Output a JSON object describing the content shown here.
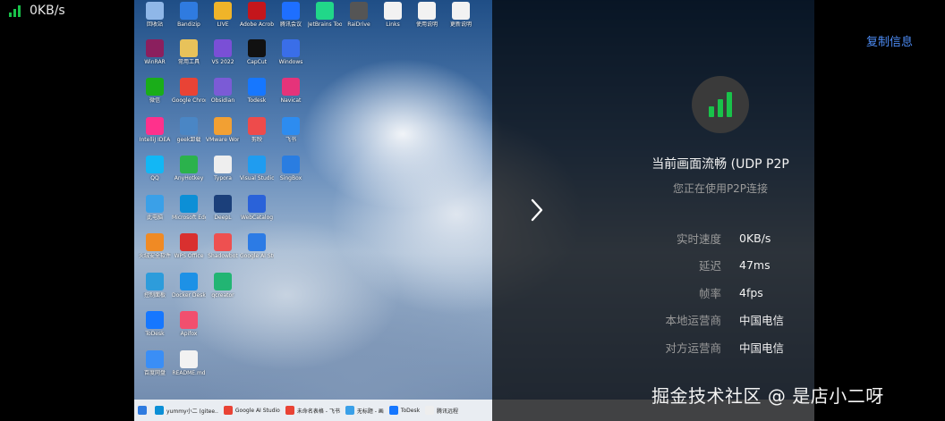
{
  "overlay": {
    "speed": "0KB/s"
  },
  "desktop": {
    "icons": [
      {
        "label": "回收站",
        "color": "#8fb7e8"
      },
      {
        "label": "Bandizip",
        "color": "#2f7be0"
      },
      {
        "label": "LIVE",
        "color": "#f0b429"
      },
      {
        "label": "Adobe Acrobat DC",
        "color": "#c4161c"
      },
      {
        "label": "腾讯会议",
        "color": "#1e6fff"
      },
      {
        "label": "JetBrains Toolbox",
        "color": "#21d789"
      },
      {
        "label": "RaiDrive",
        "color": "#555555"
      },
      {
        "label": "Links",
        "color": "#f2f2f2"
      },
      {
        "label": "使用说明",
        "color": "#f2f2f2"
      },
      {
        "label": "更新说明",
        "color": "#f2f2f2"
      },
      {
        "label": "WinRAR",
        "color": "#8b1f5e"
      },
      {
        "label": "常用工具",
        "color": "#e8c25a"
      },
      {
        "label": "VS 2022",
        "color": "#7a4fd6"
      },
      {
        "label": "CapCut",
        "color": "#111111"
      },
      {
        "label": "Windows",
        "color": "#3a6ee8"
      },
      {
        "label": "微信",
        "color": "#1aad19"
      },
      {
        "label": "Google Chrome",
        "color": "#e94335"
      },
      {
        "label": "Obsidian",
        "color": "#7b5bd6"
      },
      {
        "label": "Todesk",
        "color": "#1677ff"
      },
      {
        "label": "Navicat",
        "color": "#e5337a"
      },
      {
        "label": "IntelliJ IDEA",
        "color": "#ff318c"
      },
      {
        "label": "geek卸载",
        "color": "#4a86c5"
      },
      {
        "label": "VMware Workstation",
        "color": "#f2a033"
      },
      {
        "label": "剪映",
        "color": "#ee4b4b"
      },
      {
        "label": "飞书",
        "color": "#2d8cf0"
      },
      {
        "label": "QQ",
        "color": "#12b7f5"
      },
      {
        "label": "AnyHotkey",
        "color": "#2bb24c"
      },
      {
        "label": "Typora",
        "color": "#eeeeee"
      },
      {
        "label": "Visual Studio Code",
        "color": "#1f9cf0"
      },
      {
        "label": "SingBox",
        "color": "#2a7de1"
      },
      {
        "label": "此电脑",
        "color": "#3aa0e8"
      },
      {
        "label": "Microsoft Edge",
        "color": "#0c8fd6"
      },
      {
        "label": "DeepL",
        "color": "#1b3f7a"
      },
      {
        "label": "WebCatalog",
        "color": "#2a62d9"
      },
      {
        "label": "火绒安全软件",
        "color": "#f08a24"
      },
      {
        "label": "WPS Office",
        "color": "#d9302f"
      },
      {
        "label": "Shadowbot",
        "color": "#ee5050"
      },
      {
        "label": "Google AI Studio",
        "color": "#2c7be5"
      },
      {
        "label": "控制面板",
        "color": "#2d9cdb"
      },
      {
        "label": "Docker Desktop",
        "color": "#1d91e6"
      },
      {
        "label": "qcreator",
        "color": "#22b573"
      },
      {
        "label": "ToDesk",
        "color": "#1677ff"
      },
      {
        "label": "Apifox",
        "color": "#f14f6e"
      },
      {
        "label": "百度网盘",
        "color": "#3a8ef6"
      },
      {
        "label": "README.md",
        "color": "#f2f2f2"
      }
    ],
    "taskbar": [
      {
        "label": "",
        "color": "#2f7be0"
      },
      {
        "label": "yummy小二 (gitee..",
        "color": "#0c8fd6"
      },
      {
        "label": "Google AI Studio",
        "color": "#e94335"
      },
      {
        "label": "未命名表格 - 飞书",
        "color": "#e94335"
      },
      {
        "label": "无标题 - 画",
        "color": "#3aa0e8"
      },
      {
        "label": "ToDesk",
        "color": "#1677ff"
      },
      {
        "label": "腾讯远程",
        "color": "#eeeeee"
      }
    ]
  },
  "panel": {
    "copy_label": "复制信息",
    "headline": "当前画面流畅 (UDP P2P",
    "subline": "您正在使用P2P连接",
    "stats": [
      {
        "key": "实时速度",
        "value": "0KB/s"
      },
      {
        "key": "延迟",
        "value": "47ms"
      },
      {
        "key": "帧率",
        "value": "4fps"
      },
      {
        "key": "本地运营商",
        "value": "中国电信"
      },
      {
        "key": "对方运营商",
        "value": "中国电信"
      }
    ],
    "accent_color": "#19c24a",
    "link_color": "#4d8cf5"
  },
  "watermark": "掘金技术社区 @ 是店小二呀"
}
